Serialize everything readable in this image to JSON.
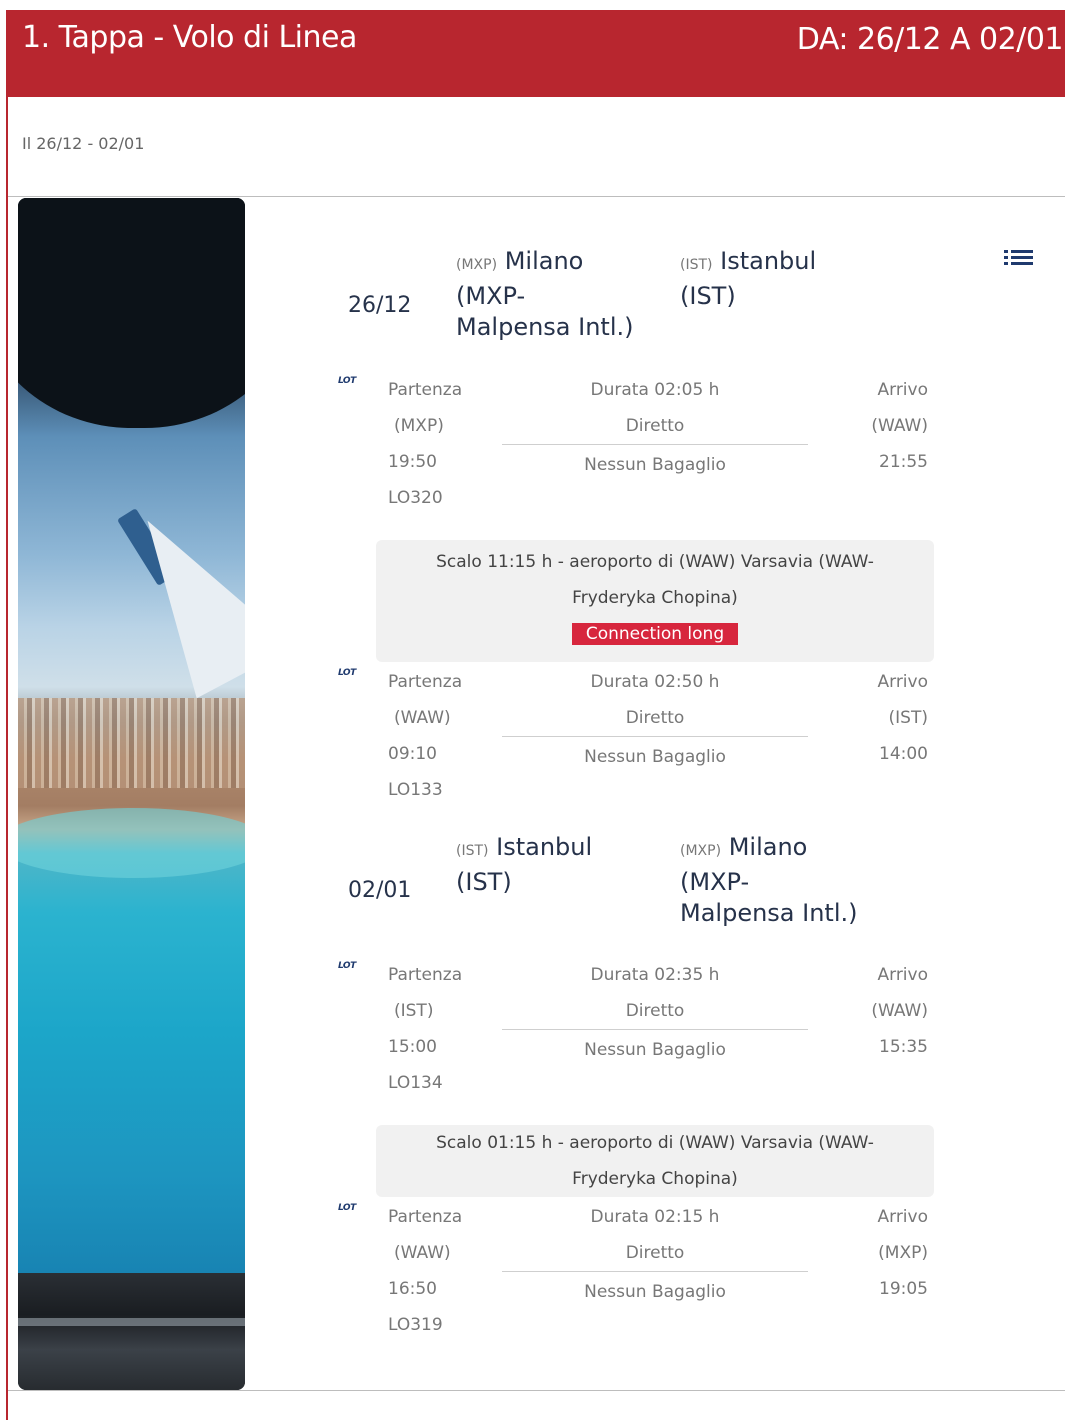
{
  "header": {
    "title": "1. Tappa - Volo di Linea",
    "dates": "DA: 26/12 A 02/01",
    "color": "#b8262f"
  },
  "subline": "Il 26/12 - 02/01",
  "menu_icon": "list-icon",
  "trips": [
    {
      "date": "26/12",
      "from": {
        "code": "(MXP)",
        "name": "Milano (MXP- Malpensa Intl.)"
      },
      "to": {
        "code": "(IST)",
        "name": "Istanbul (IST)"
      },
      "segments": [
        {
          "airline": "LOT",
          "dep_label": "Partenza",
          "dep_code": "(MXP)",
          "dep_time": "19:50",
          "flight": "LO320",
          "duration": "Durata 02:05 h",
          "type": "Diretto",
          "baggage": "Nessun Bagaglio",
          "arr_label": "Arrivo",
          "arr_code": "(WAW)",
          "arr_time": "21:55"
        },
        {
          "airline": "LOT",
          "dep_label": "Partenza",
          "dep_code": "(WAW)",
          "dep_time": "09:10",
          "flight": "LO133",
          "duration": "Durata 02:50 h",
          "type": "Diretto",
          "baggage": "Nessun Bagaglio",
          "arr_label": "Arrivo",
          "arr_code": "(IST)",
          "arr_time": "14:00"
        }
      ],
      "layover": {
        "line1": "Scalo 11:15 h - aeroporto di (WAW) Varsavia (WAW-",
        "line2": "Fryderyka Chopina)",
        "badge": "Connection long"
      }
    },
    {
      "date": "02/01",
      "from": {
        "code": "(IST)",
        "name": "Istanbul (IST)"
      },
      "to": {
        "code": "(MXP)",
        "name": "Milano (MXP- Malpensa Intl.)"
      },
      "segments": [
        {
          "airline": "LOT",
          "dep_label": "Partenza",
          "dep_code": "(IST)",
          "dep_time": "15:00",
          "flight": "LO134",
          "duration": "Durata 02:35 h",
          "type": "Diretto",
          "baggage": "Nessun Bagaglio",
          "arr_label": "Arrivo",
          "arr_code": "(WAW)",
          "arr_time": "15:35"
        },
        {
          "airline": "LOT",
          "dep_label": "Partenza",
          "dep_code": "(WAW)",
          "dep_time": "16:50",
          "flight": "LO319",
          "duration": "Durata 02:15 h",
          "type": "Diretto",
          "baggage": "Nessun Bagaglio",
          "arr_label": "Arrivo",
          "arr_code": "(MXP)",
          "arr_time": "19:05"
        }
      ],
      "layover": {
        "line1": "Scalo 01:15 h - aeroporto di (WAW) Varsavia (WAW-",
        "line2": "Fryderyka Chopina)"
      }
    }
  ]
}
